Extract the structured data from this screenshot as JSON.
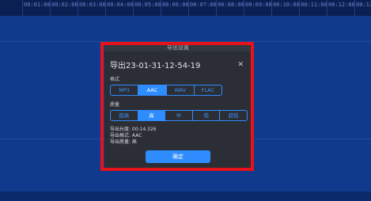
{
  "timeline": {
    "ticks": [
      "00:01:00",
      "00:02:00",
      "00:03:00",
      "00:04:00",
      "00:05:00",
      "00:06:00",
      "00:07:00",
      "00:08:00",
      "00:09:00",
      "00:10:00",
      "00:11:00",
      "00:12:00",
      "00:13:00"
    ]
  },
  "dialog": {
    "header": "导出设置",
    "title": "导出23-01-31-12-54-19",
    "close_glyph": "✕",
    "format": {
      "label": "格式",
      "options": [
        "MP3",
        "AAC",
        "WAV",
        "FLAC"
      ],
      "selected": "AAC"
    },
    "quality": {
      "label": "质量",
      "options": [
        "超高",
        "高",
        "中",
        "低",
        "超低"
      ],
      "selected": "高"
    },
    "info": {
      "length": "导出长度: 00:14.326",
      "format": "导出格式: AAC",
      "quality": "导出质量: 高"
    },
    "confirm_label": "确定"
  },
  "colors": {
    "accent": "#2f8cff",
    "highlight": "#e8121b",
    "background": "#103b8c",
    "dialog": "#2b2e35"
  }
}
